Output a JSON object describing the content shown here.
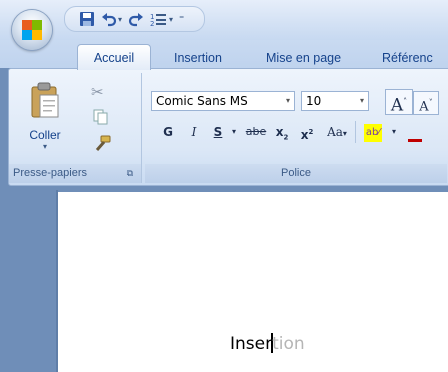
{
  "qat": {
    "icons": [
      "save-icon",
      "undo-icon",
      "redo-icon",
      "list-icon",
      "customize-icon"
    ]
  },
  "tabs": {
    "accueil": "Accueil",
    "insertion": "Insertion",
    "mise_en_page": "Mise en page",
    "references": "Référenc"
  },
  "clipboard": {
    "paste_label": "Coller",
    "group_label": "Presse-papiers"
  },
  "font": {
    "name": "Comic Sans MS",
    "size": "10",
    "group_label": "Police",
    "bold": "G",
    "italic": "I",
    "underline": "S",
    "strike": "abe",
    "subscript": "x",
    "superscript": "x",
    "case": "Aa",
    "highlight": "ab"
  },
  "document": {
    "typed_text": "Inser",
    "ghost_text": "tion"
  },
  "colors": {
    "accent": "#15428b",
    "ribbon": "#dbe7f6",
    "highlight": "#ffff00"
  }
}
